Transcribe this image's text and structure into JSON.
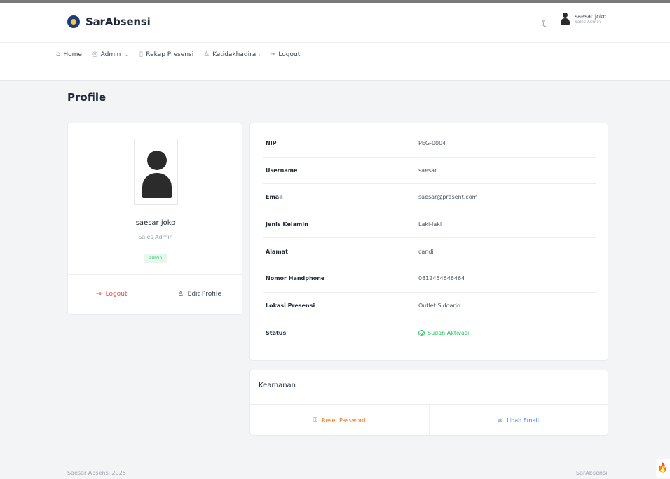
{
  "brand": {
    "name": "SarAbsensi"
  },
  "topbar": {
    "user_name": "saesar joko",
    "user_role": "Sales Admin"
  },
  "nav": [
    {
      "label": "Home",
      "icon": "home-icon",
      "glyph": "⌂"
    },
    {
      "label": "Admin",
      "icon": "admin-icon",
      "glyph": "◎",
      "caret": "⌄"
    },
    {
      "label": "Rekap Presensi",
      "icon": "clipboard-icon",
      "glyph": "▯"
    },
    {
      "label": "Ketidakhadiran",
      "icon": "user-icon",
      "glyph": "♙"
    },
    {
      "label": "Logout",
      "icon": "logout-icon",
      "glyph": "⇥"
    }
  ],
  "page": {
    "title": "Profile"
  },
  "profile": {
    "name": "saesar joko",
    "role": "Sales Admin",
    "badge": "admin",
    "logout_label": "Logout",
    "edit_label": "Edit Profile"
  },
  "info": [
    {
      "label": "NIP",
      "value": "PEG-0004"
    },
    {
      "label": "Username",
      "value": "saesar"
    },
    {
      "label": "Email",
      "value": "saesar@present.com"
    },
    {
      "label": "Jenis Kelamin",
      "value": "Laki-laki"
    },
    {
      "label": "Alamat",
      "value": "candi"
    },
    {
      "label": "Nomor Handphone",
      "value": "0812454646464"
    },
    {
      "label": "Lokasi Presensi",
      "value": "Outlet Sidoarjo"
    },
    {
      "label": "Status",
      "value": "Sudah Aktivasi"
    }
  ],
  "security": {
    "title": "Keamanan",
    "reset_label": "Reset Password",
    "email_label": "Ubah Email"
  },
  "footer": {
    "left": "Saesar Absensi 2025",
    "right": "SarAbsensi"
  },
  "colors": {
    "danger": "#ef4444",
    "success": "#22c55e",
    "warning": "#f97316",
    "info": "#3b82f6"
  }
}
